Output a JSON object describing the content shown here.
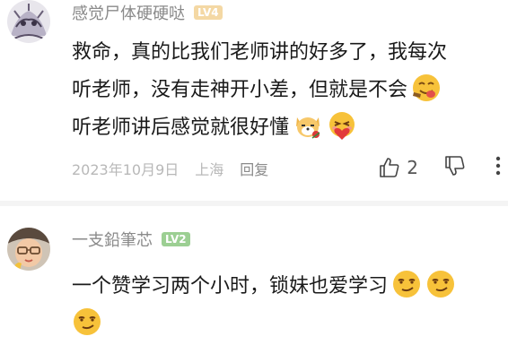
{
  "comments": [
    {
      "username": "感觉尸体硬硬哒",
      "level": "LV4",
      "text_lines": [
        "救命，真的比我们老师讲的好多了，我每次",
        "听老师，没有走神开小差，但就是不会",
        "听老师讲后感觉就很好懂"
      ],
      "emojis": [
        "tongue-emoji",
        "flower-dog-emoji",
        "heart-hug-emoji"
      ],
      "date": "2023年10月9日",
      "location": "上海",
      "reply_label": "回复",
      "like_count": "2"
    },
    {
      "username": "一支鉛筆芯",
      "level": "LV2",
      "text_lines": [
        "一个赞学习两个小时，锁妹也爱学习"
      ],
      "emojis": [
        "smirk-emoji",
        "smirk-emoji",
        "smirk-emoji"
      ]
    }
  ],
  "colors": {
    "username": "#8a8a8a",
    "text": "#1a1a1a",
    "meta": "#b8b8b8",
    "lv4_badge": "#f4d8a4",
    "lv2_badge": "#9ccf93"
  }
}
